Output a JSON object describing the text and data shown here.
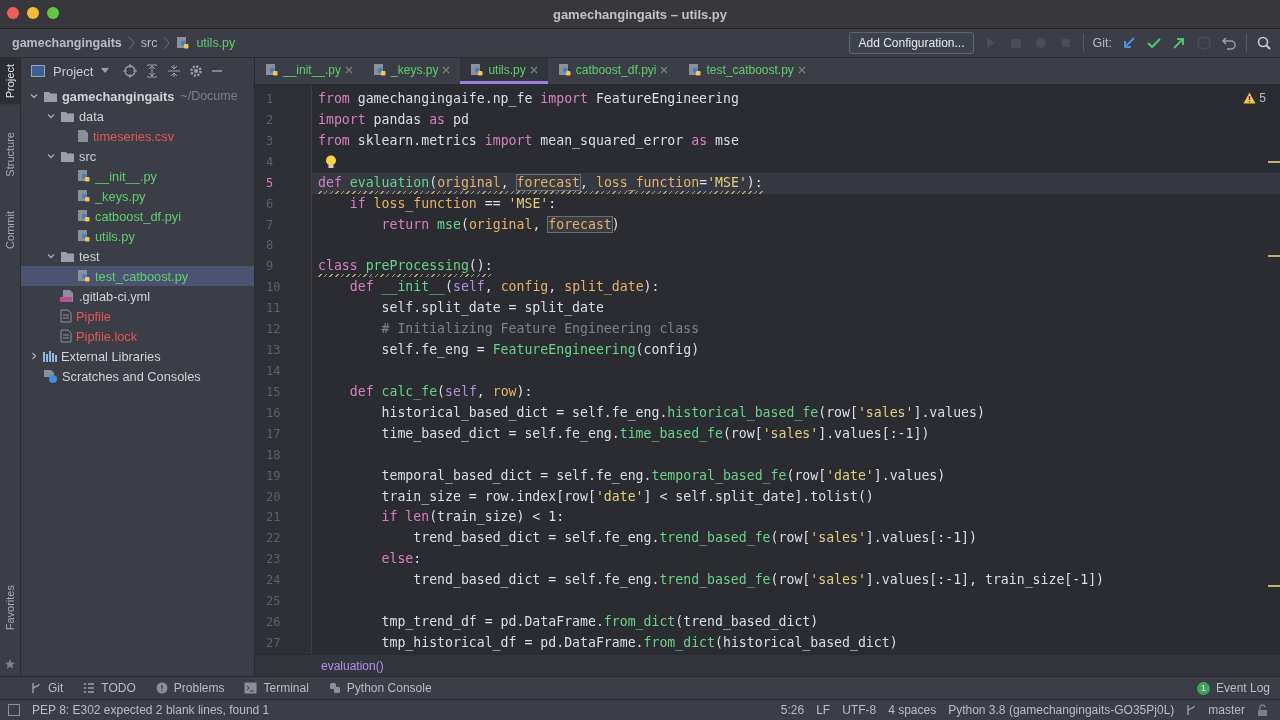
{
  "window": {
    "title": "gamechangingaits – utils.py"
  },
  "breadcrumb": [
    "gamechangingaits",
    "src",
    "utils.py"
  ],
  "toolbar": {
    "config_button": "Add Configuration...",
    "git_label": "Git:"
  },
  "side_strip": {
    "top": [
      {
        "label": "Project",
        "selected": true
      },
      {
        "label": "Structure",
        "selected": false
      },
      {
        "label": "Commit",
        "selected": false
      }
    ],
    "bottom": [
      {
        "label": "Favorites",
        "selected": false
      }
    ]
  },
  "project_panel": {
    "title": "Project"
  },
  "tree": [
    {
      "label": "gamechangingaits",
      "path": "~/Docume",
      "kind": "folder",
      "expanded": true,
      "selected": false,
      "color": "#d0d3d8",
      "children": [
        {
          "label": "data",
          "kind": "folder",
          "expanded": true,
          "selected": false,
          "color": "#d0d3d8",
          "children": [
            {
              "label": "timeseries.csv",
              "kind": "csv",
              "selected": false,
              "color": "#e0575b"
            }
          ]
        },
        {
          "label": "src",
          "kind": "folder",
          "expanded": true,
          "selected": false,
          "color": "#d0d3d8",
          "children": [
            {
              "label": "__init__.py",
              "kind": "python",
              "selected": false,
              "color": "#5fcf6e"
            },
            {
              "label": "_keys.py",
              "kind": "python",
              "selected": false,
              "color": "#5fcf6e"
            },
            {
              "label": "catboost_df.pyi",
              "kind": "python",
              "selected": false,
              "color": "#5fcf6e"
            },
            {
              "label": "utils.py",
              "kind": "python",
              "selected": false,
              "color": "#5fcf6e"
            }
          ]
        },
        {
          "label": "test",
          "kind": "folder",
          "expanded": true,
          "selected": false,
          "color": "#d0d3d8",
          "children": [
            {
              "label": "test_catboost.py",
              "kind": "python",
              "selected": true,
              "color": "#5fcf6e"
            }
          ]
        },
        {
          "label": ".gitlab-ci.yml",
          "kind": "yml",
          "selected": false,
          "color": "#d0d3d8"
        },
        {
          "label": "Pipfile",
          "kind": "file",
          "selected": false,
          "color": "#e0575b"
        },
        {
          "label": "Pipfile.lock",
          "kind": "file",
          "selected": false,
          "color": "#e0575b"
        }
      ]
    },
    {
      "label": "External Libraries",
      "kind": "libraries",
      "expanded": false,
      "selected": false,
      "color": "#d0d3d8"
    },
    {
      "label": "Scratches and Consoles",
      "kind": "scratches",
      "selected": false,
      "color": "#d0d3d8"
    }
  ],
  "tabs": [
    {
      "label": "__init__.py",
      "selected": false
    },
    {
      "label": "_keys.py",
      "selected": false
    },
    {
      "label": "utils.py",
      "selected": true
    },
    {
      "label": "catboost_df.pyi",
      "selected": false
    },
    {
      "label": "test_catboost.py",
      "selected": false
    }
  ],
  "editor": {
    "warning_count": "5",
    "lines": [
      {
        "n": "1",
        "current": false,
        "warning": false,
        "bulb": false,
        "tokens": [
          {
            "t": "from",
            "kind": "kw"
          },
          {
            "t": " gamechangingaife.np_fe ",
            "kind": "plain"
          },
          {
            "t": "import",
            "kind": "kw"
          },
          {
            "t": " FeatureEngineering",
            "kind": "plain"
          }
        ]
      },
      {
        "n": "2",
        "current": false,
        "warning": false,
        "bulb": false,
        "tokens": [
          {
            "t": "import",
            "kind": "kw"
          },
          {
            "t": " pandas ",
            "kind": "plain"
          },
          {
            "t": "as",
            "kind": "kw"
          },
          {
            "t": " pd",
            "kind": "plain"
          }
        ]
      },
      {
        "n": "3",
        "current": false,
        "warning": false,
        "bulb": false,
        "tokens": [
          {
            "t": "from",
            "kind": "kw"
          },
          {
            "t": " sklearn.metrics ",
            "kind": "plain"
          },
          {
            "t": "import",
            "kind": "kw"
          },
          {
            "t": " mean_squared_error ",
            "kind": "plain"
          },
          {
            "t": "as",
            "kind": "kw"
          },
          {
            "t": " mse",
            "kind": "plain"
          }
        ]
      },
      {
        "n": "4",
        "current": false,
        "bulb": true
      },
      {
        "n": "5",
        "current": true,
        "warning": true,
        "bulb": false,
        "tokens": [
          {
            "t": "def ",
            "kind": "kw"
          },
          {
            "t": "evaluation",
            "kind": "fn"
          },
          {
            "t": "(",
            "kind": "plain"
          },
          {
            "t": "original",
            "kind": "param"
          },
          {
            "t": ", ",
            "kind": "plain"
          },
          {
            "t": "forecast",
            "kind": "ref"
          },
          {
            "t": ", ",
            "kind": "plain"
          },
          {
            "t": "loss_function",
            "kind": "param"
          },
          {
            "t": "=",
            "kind": "plain"
          },
          {
            "t": "'MSE'",
            "kind": "str"
          },
          {
            "t": "):",
            "kind": "plain"
          }
        ]
      },
      {
        "n": "6",
        "current": false,
        "warning": false,
        "bulb": false,
        "tokens": [
          {
            "t": "    if ",
            "kind": "kw"
          },
          {
            "t": "loss_function",
            "kind": "param"
          },
          {
            "t": " == ",
            "kind": "plain"
          },
          {
            "t": "'MSE'",
            "kind": "str"
          },
          {
            "t": ":",
            "kind": "plain"
          }
        ]
      },
      {
        "n": "7",
        "current": false,
        "warning": false,
        "bulb": false,
        "tokens": [
          {
            "t": "        return ",
            "kind": "kw"
          },
          {
            "t": "mse",
            "kind": "fn"
          },
          {
            "t": "(",
            "kind": "plain"
          },
          {
            "t": "original",
            "kind": "param"
          },
          {
            "t": ", ",
            "kind": "plain"
          },
          {
            "t": "forecast",
            "kind": "ref"
          },
          {
            "t": ")",
            "kind": "plain"
          }
        ]
      },
      {
        "n": "8",
        "current": false,
        "bulb": false
      },
      {
        "n": "9",
        "current": false,
        "warning": true,
        "bulb": false,
        "tokens": [
          {
            "t": "class ",
            "kind": "kw"
          },
          {
            "t": "preProcessing",
            "kind": "fn"
          },
          {
            "t": "():",
            "kind": "plain"
          }
        ]
      },
      {
        "n": "10",
        "current": false,
        "warning": false,
        "bulb": false,
        "tokens": [
          {
            "t": "    def ",
            "kind": "kw"
          },
          {
            "t": "__init__",
            "kind": "fn"
          },
          {
            "t": "(",
            "kind": "plain"
          },
          {
            "t": "self",
            "kind": "self"
          },
          {
            "t": ", ",
            "kind": "plain"
          },
          {
            "t": "config",
            "kind": "param"
          },
          {
            "t": ", ",
            "kind": "plain"
          },
          {
            "t": "split_date",
            "kind": "param"
          },
          {
            "t": "):",
            "kind": "plain"
          }
        ]
      },
      {
        "n": "11",
        "current": false,
        "warning": false,
        "bulb": false,
        "tokens": [
          {
            "t": "        self.split_date = split_date",
            "kind": "plain"
          }
        ]
      },
      {
        "n": "12",
        "current": false,
        "warning": false,
        "bulb": false,
        "tokens": [
          {
            "t": "        # Initializing Feature Engineering class",
            "kind": "comment"
          }
        ]
      },
      {
        "n": "13",
        "current": false,
        "warning": false,
        "bulb": false,
        "tokens": [
          {
            "t": "        self.fe_eng = ",
            "kind": "plain"
          },
          {
            "t": "FeatureEngineering",
            "kind": "fn"
          },
          {
            "t": "(config)",
            "kind": "plain"
          }
        ]
      },
      {
        "n": "14",
        "current": false,
        "bulb": false
      },
      {
        "n": "15",
        "current": false,
        "warning": false,
        "bulb": false,
        "tokens": [
          {
            "t": "    def ",
            "kind": "kw"
          },
          {
            "t": "calc_fe",
            "kind": "fn"
          },
          {
            "t": "(",
            "kind": "plain"
          },
          {
            "t": "self",
            "kind": "self"
          },
          {
            "t": ", ",
            "kind": "plain"
          },
          {
            "t": "row",
            "kind": "param"
          },
          {
            "t": "):",
            "kind": "plain"
          }
        ]
      },
      {
        "n": "16",
        "current": false,
        "warning": false,
        "bulb": false,
        "tokens": [
          {
            "t": "        historical_based_dict = self.fe_eng.",
            "kind": "plain"
          },
          {
            "t": "historical_based_fe",
            "kind": "fn"
          },
          {
            "t": "(row[",
            "kind": "plain"
          },
          {
            "t": "'sales'",
            "kind": "str"
          },
          {
            "t": "].values)",
            "kind": "plain"
          }
        ]
      },
      {
        "n": "17",
        "current": false,
        "warning": false,
        "bulb": false,
        "tokens": [
          {
            "t": "        time_based_dict = self.fe_eng.",
            "kind": "plain"
          },
          {
            "t": "time_based_fe",
            "kind": "fn"
          },
          {
            "t": "(row[",
            "kind": "plain"
          },
          {
            "t": "'sales'",
            "kind": "str"
          },
          {
            "t": "].values[:-1])",
            "kind": "plain"
          }
        ]
      },
      {
        "n": "18",
        "current": false,
        "bulb": false
      },
      {
        "n": "19",
        "current": false,
        "warning": false,
        "bulb": false,
        "tokens": [
          {
            "t": "        temporal_based_dict = self.fe_eng.",
            "kind": "plain"
          },
          {
            "t": "temporal_based_fe",
            "kind": "fn"
          },
          {
            "t": "(row[",
            "kind": "plain"
          },
          {
            "t": "'date'",
            "kind": "str"
          },
          {
            "t": "].values)",
            "kind": "plain"
          }
        ]
      },
      {
        "n": "20",
        "current": false,
        "warning": false,
        "bulb": false,
        "tokens": [
          {
            "t": "        train_size = row.index[row[",
            "kind": "plain"
          },
          {
            "t": "'date'",
            "kind": "str"
          },
          {
            "t": "] < self.split_date].tolist()",
            "kind": "plain"
          }
        ]
      },
      {
        "n": "21",
        "current": false,
        "warning": false,
        "bulb": false,
        "tokens": [
          {
            "t": "        if len",
            "kind": "kw"
          },
          {
            "t": "(train_size) < 1:",
            "kind": "plain"
          }
        ]
      },
      {
        "n": "22",
        "current": false,
        "warning": false,
        "bulb": false,
        "tokens": [
          {
            "t": "            trend_based_dict = self.fe_eng.",
            "kind": "plain"
          },
          {
            "t": "trend_based_fe",
            "kind": "fn"
          },
          {
            "t": "(row[",
            "kind": "plain"
          },
          {
            "t": "'sales'",
            "kind": "str"
          },
          {
            "t": "].values[:-1])",
            "kind": "plain"
          }
        ]
      },
      {
        "n": "23",
        "current": false,
        "warning": false,
        "bulb": false,
        "tokens": [
          {
            "t": "        else",
            "kind": "kw"
          },
          {
            "t": ":",
            "kind": "plain"
          }
        ]
      },
      {
        "n": "24",
        "current": false,
        "warning": false,
        "bulb": false,
        "tokens": [
          {
            "t": "            trend_based_dict = self.fe_eng.",
            "kind": "plain"
          },
          {
            "t": "trend_based_fe",
            "kind": "fn"
          },
          {
            "t": "(row[",
            "kind": "plain"
          },
          {
            "t": "'sales'",
            "kind": "str"
          },
          {
            "t": "].values[:-1], train_size[-1])",
            "kind": "plain"
          }
        ]
      },
      {
        "n": "25",
        "current": false,
        "bulb": false
      },
      {
        "n": "26",
        "current": false,
        "warning": false,
        "bulb": false,
        "tokens": [
          {
            "t": "        tmp_trend_df = pd.DataFrame.",
            "kind": "plain"
          },
          {
            "t": "from_dict",
            "kind": "fn"
          },
          {
            "t": "(trend_based_dict)",
            "kind": "plain"
          }
        ]
      },
      {
        "n": "27",
        "current": false,
        "warning": false,
        "bulb": false,
        "tokens": [
          {
            "t": "        tmp_historical_df = pd.DataFrame.",
            "kind": "plain"
          },
          {
            "t": "from_dict",
            "kind": "fn"
          },
          {
            "t": "(historical_based_dict)",
            "kind": "plain"
          }
        ]
      }
    ],
    "context": "evaluation()"
  },
  "tool_windows": [
    {
      "label": "Git",
      "kind": "git"
    },
    {
      "label": "TODO",
      "kind": "todo"
    },
    {
      "label": "Problems",
      "kind": "problems"
    },
    {
      "label": "Terminal",
      "kind": "terminal"
    },
    {
      "label": "Python Console",
      "kind": "console"
    }
  ],
  "event_log": {
    "label": "Event Log",
    "count": "1"
  },
  "status_bar": {
    "message": "PEP 8: E302 expected 2 blank lines, found 1",
    "position": "5:26",
    "line_ending": "LF",
    "encoding": "UTF-8",
    "indent": "4 spaces",
    "interpreter": "Python 3.8 (gamechangingaits-GO35Pj0L)",
    "branch": "master"
  }
}
